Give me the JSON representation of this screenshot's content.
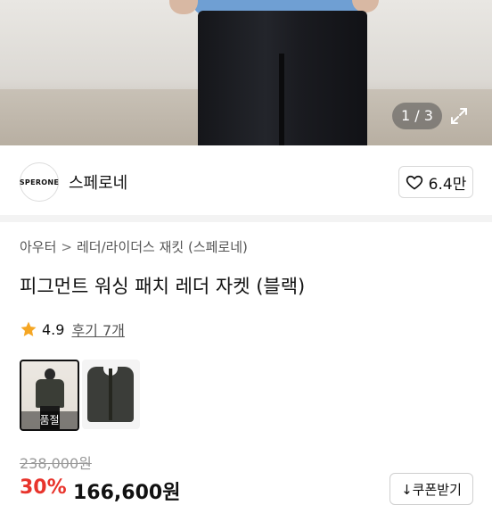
{
  "gallery": {
    "counter": "1 / 3",
    "current": 1,
    "total": 3,
    "expand_icon": "expand-icon"
  },
  "seller": {
    "logo_text": "SPERONE",
    "name": "스페로네",
    "likes": "6.4만",
    "like_icon": "heart-icon"
  },
  "breadcrumb": {
    "category": "아우터",
    "separator": ">",
    "subcategory": "레더/라이더스 재킷 (스페로네)"
  },
  "product": {
    "title": "피그먼트 워싱 패치 레더 자켓 (블랙)",
    "rating": "4.9",
    "review_link": "후기 7개",
    "thumbnails": [
      {
        "label": "품절",
        "selected": true
      },
      {
        "label": "",
        "selected": false
      }
    ],
    "original_price": "238,000원",
    "discount": "30%",
    "price": "166,600원",
    "coupon_button": "↓쿠폰받기"
  },
  "colors": {
    "discount": "#e8342c",
    "star": "#f5a623"
  }
}
